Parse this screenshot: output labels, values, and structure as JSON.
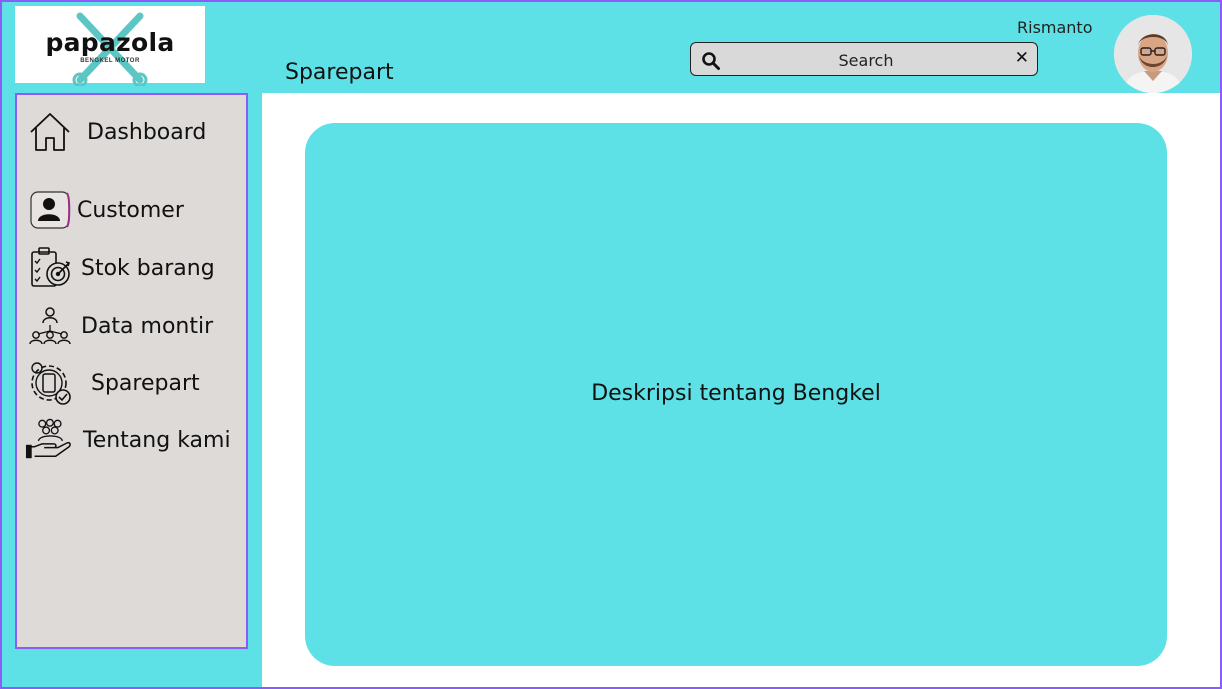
{
  "brand": {
    "name": "papazola",
    "tagline": "BENGKEL MOTOR"
  },
  "header": {
    "page_title": "Sparepart",
    "search_placeholder": "Search",
    "user_name": "Rismanto"
  },
  "sidebar": {
    "items": [
      {
        "label": "Dashboard",
        "icon": "home-icon"
      },
      {
        "label": "Customer",
        "icon": "user-icon"
      },
      {
        "label": "Stok barang",
        "icon": "clipboard-target-icon"
      },
      {
        "label": "Data montir",
        "icon": "team-hierarchy-icon"
      },
      {
        "label": "Sparepart",
        "icon": "gear-phone-icon"
      },
      {
        "label": "Tentang kami",
        "icon": "hand-people-icon"
      }
    ]
  },
  "main": {
    "description": "Deskripsi tentang Bengkel"
  },
  "colors": {
    "accent": "#5de1e6",
    "sidebar_bg": "#dedad8",
    "border": "#8b5cf6"
  }
}
